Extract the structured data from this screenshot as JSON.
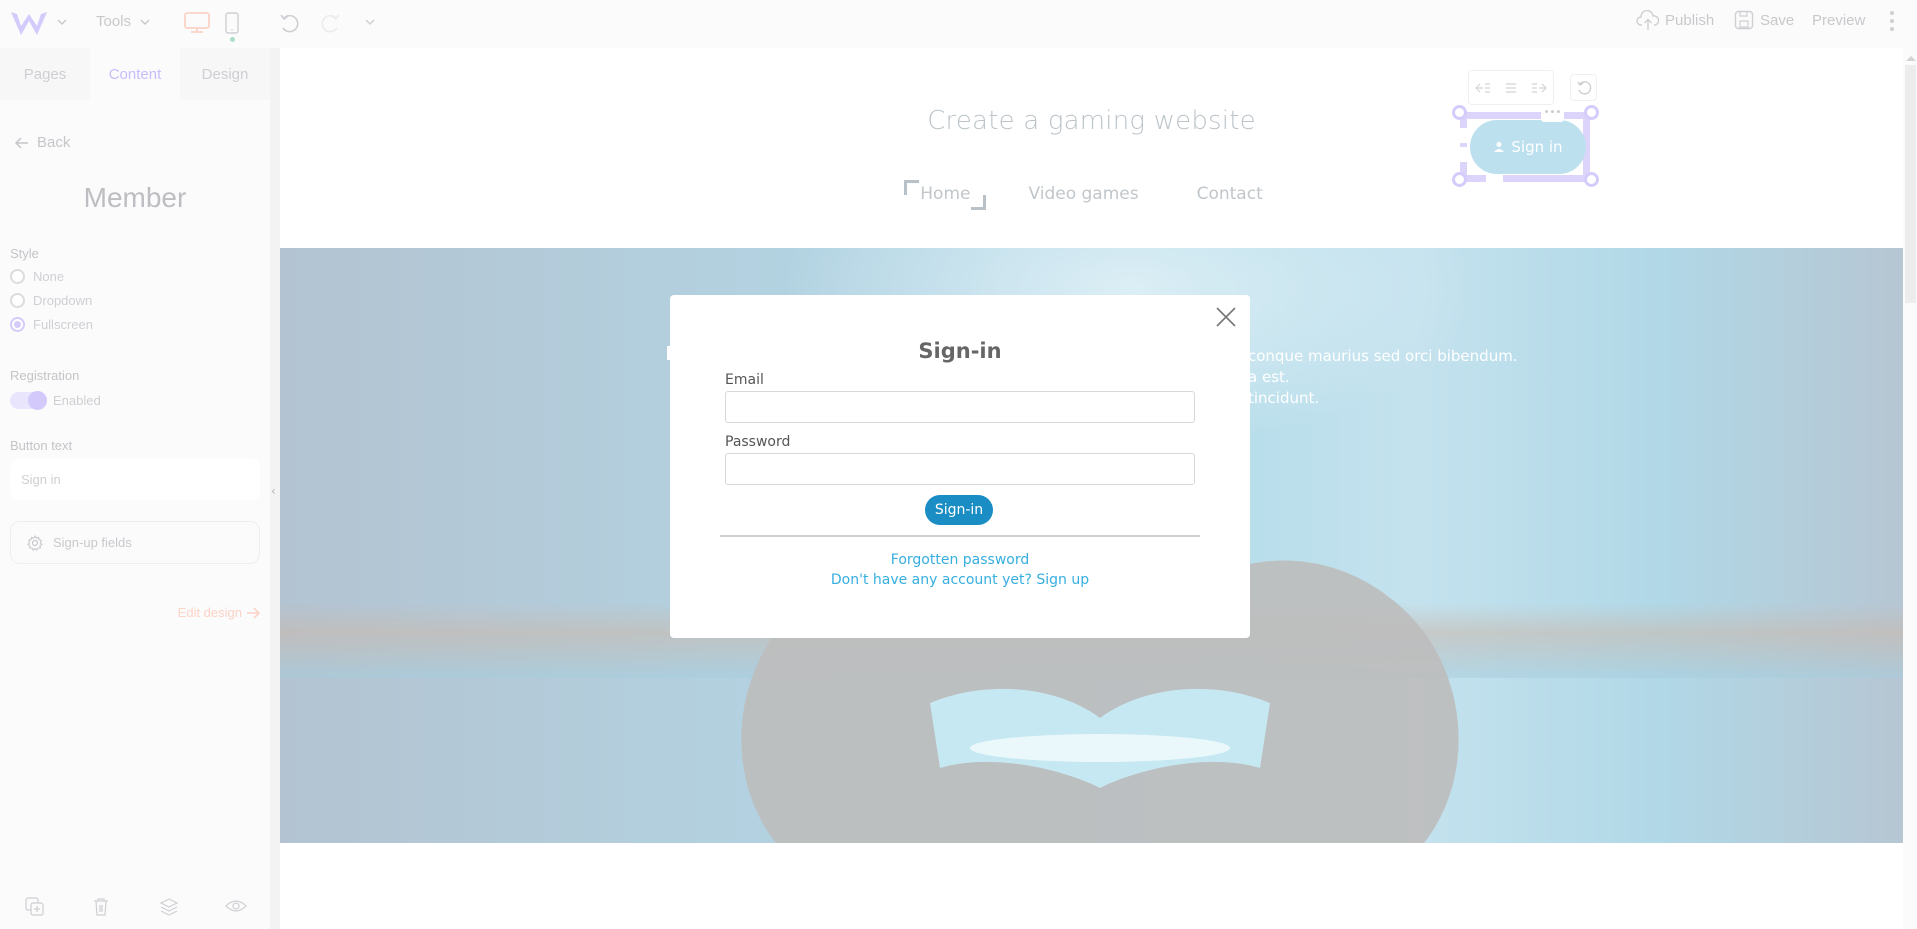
{
  "topbar": {
    "tools_label": "Tools",
    "publish_label": "Publish",
    "save_label": "Save",
    "preview_label": "Preview",
    "accent_desktop": "#fbd3c7",
    "logo_color": "#d3cbfb"
  },
  "sidebar": {
    "tabs": [
      {
        "label": "Pages"
      },
      {
        "label": "Content"
      },
      {
        "label": "Design"
      }
    ],
    "back_label": "Back",
    "title": "Member",
    "style_label": "Style",
    "style_options": [
      {
        "label": "None",
        "selected": false
      },
      {
        "label": "Dropdown",
        "selected": false
      },
      {
        "label": "Fullscreen",
        "selected": true
      }
    ],
    "registration_label": "Registration",
    "registration_toggle_label": "Enabled",
    "registration_enabled": true,
    "button_text_label": "Button text",
    "button_text_value": "Sign in",
    "signup_fields_label": "Sign-up fields",
    "edit_design_label": "Edit design"
  },
  "site": {
    "title": "Create a gaming website",
    "nav": [
      {
        "label": "Home",
        "active": true
      },
      {
        "label": "Video games",
        "active": false
      },
      {
        "label": "Contact",
        "active": false
      }
    ],
    "member_button_label": "Sign in",
    "hero_text_lines": [
      "conque maurius sed orci bibendum.",
      "a est.",
      "tincidunt."
    ]
  },
  "modal": {
    "title": "Sign-in",
    "email_label": "Email",
    "email_value": "",
    "password_label": "Password",
    "password_value": "",
    "submit_label": "Sign-in",
    "forgot_link": "Forgotten password",
    "signup_link": "Don't have any account yet? Sign up",
    "accent": "#1a8dc4",
    "link_color": "#36aee0"
  }
}
